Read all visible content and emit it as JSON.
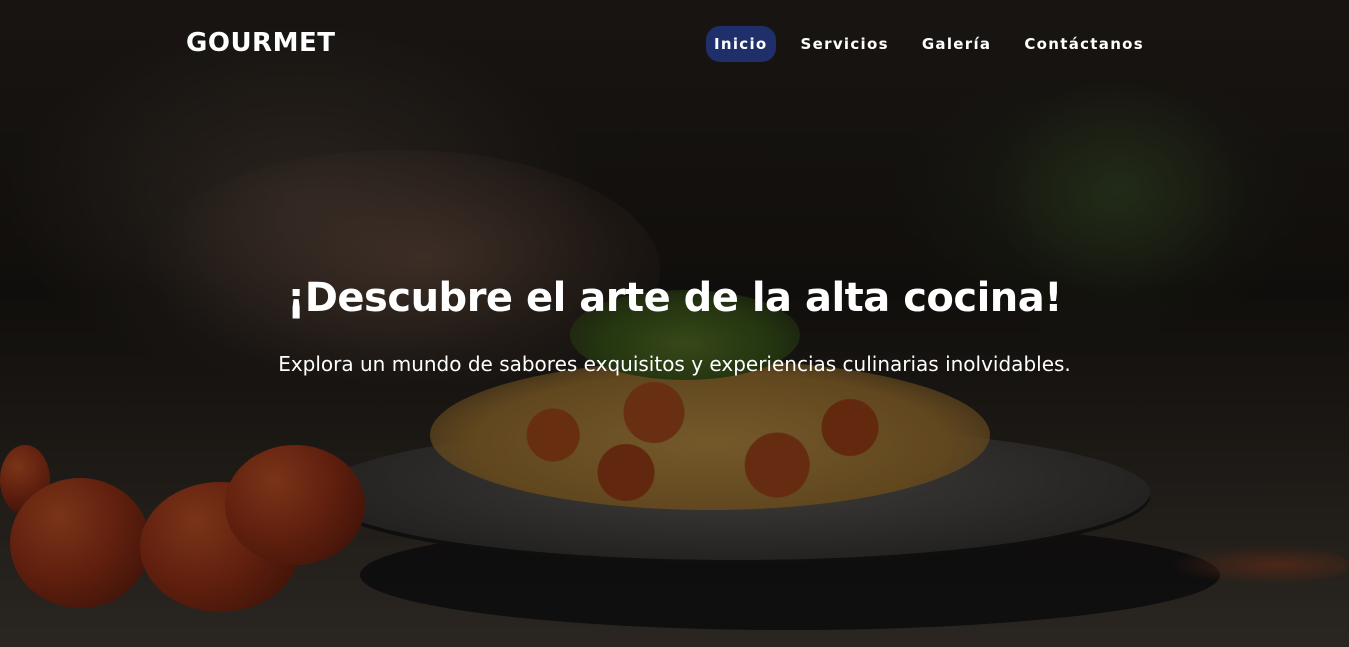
{
  "brand": {
    "logo_text": "GOURMET"
  },
  "nav": {
    "items": [
      {
        "label": "Inicio",
        "active": true
      },
      {
        "label": "Servicios",
        "active": false
      },
      {
        "label": "Galería",
        "active": false
      },
      {
        "label": "Contáctanos",
        "active": false
      }
    ]
  },
  "hero": {
    "title": "¡Descubre el arte de la alta cocina!",
    "subtitle": "Explora un mundo de sabores exquisitos y experiencias culinarias inolvidables."
  },
  "colors": {
    "active_nav_bg": "#1e2f6a",
    "text": "#ffffff"
  }
}
